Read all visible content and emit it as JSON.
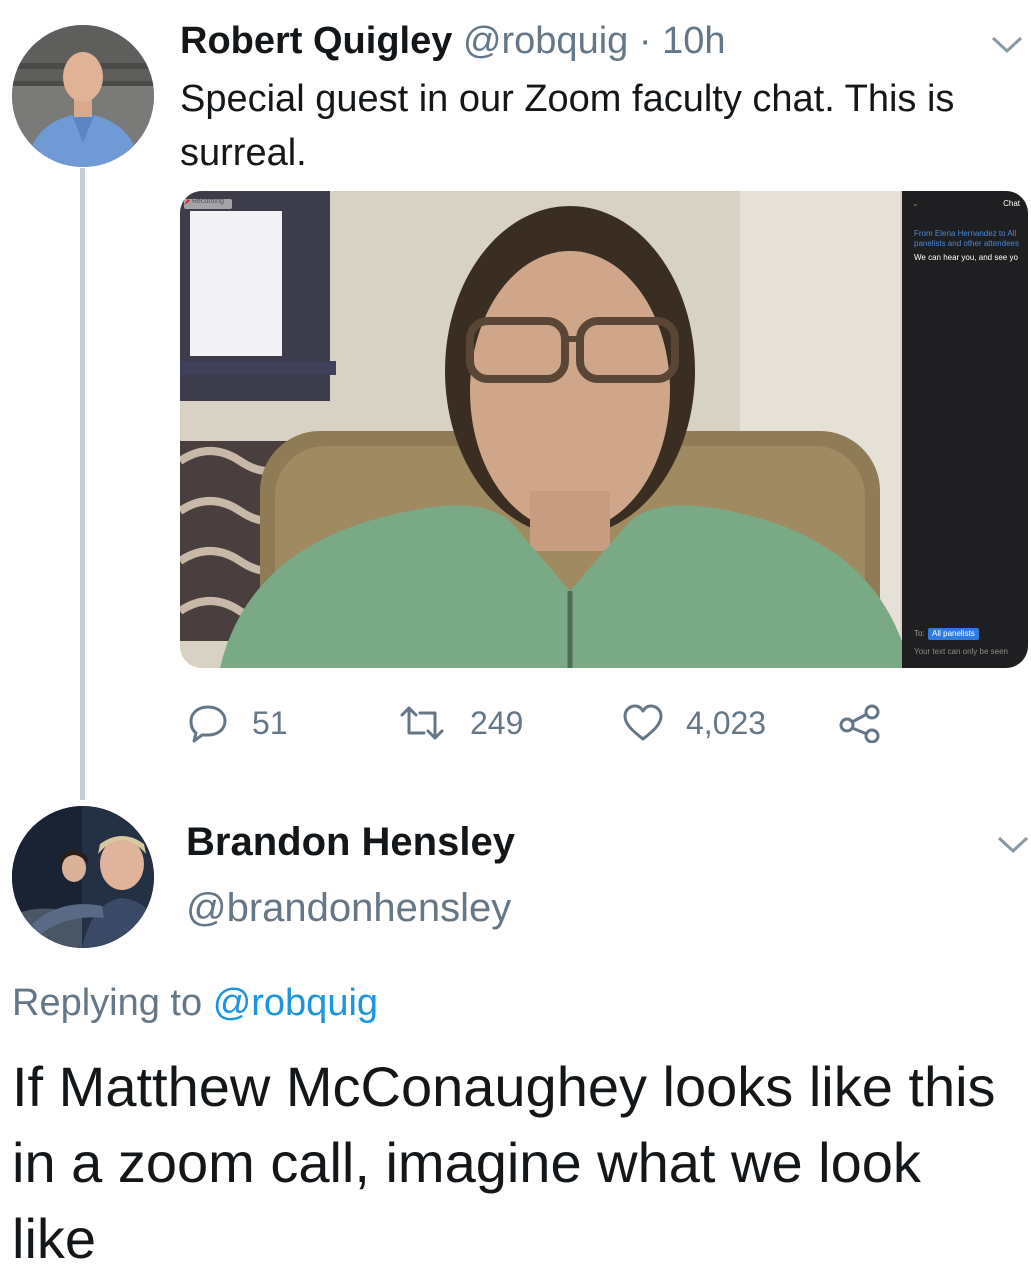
{
  "tweet": {
    "author_name": "Robert Quigley",
    "author_handle": "@robquig",
    "separator": "·",
    "time": "10h",
    "text": "Special guest in our Zoom faculty chat. This is surreal.",
    "media": {
      "recording_label": "Recording",
      "chat_title": "Chat",
      "chat_from": "From Elena Hernandez to All panelists and other attendees",
      "chat_message": "We can hear you, and see yo",
      "to_label": "To:",
      "to_value": "All panelists",
      "footer_note": "Your text can only be seen"
    },
    "actions": {
      "replies": "51",
      "retweets": "249",
      "likes": "4,023"
    }
  },
  "reply": {
    "author_name": "Brandon Hensley",
    "author_handle": "@brandonhensley",
    "replying_prefix": "Replying to",
    "replying_to": "@robquig",
    "text": "If Matthew McConaughey looks like this in a zoom call, imagine what we look like"
  },
  "colors": {
    "text": "#14171a",
    "secondary": "#657786",
    "link": "#1b95e0",
    "thread_line": "#c4cfd6"
  },
  "icons": [
    "chevron-down-icon",
    "reply-icon",
    "retweet-icon",
    "like-icon",
    "share-icon"
  ]
}
